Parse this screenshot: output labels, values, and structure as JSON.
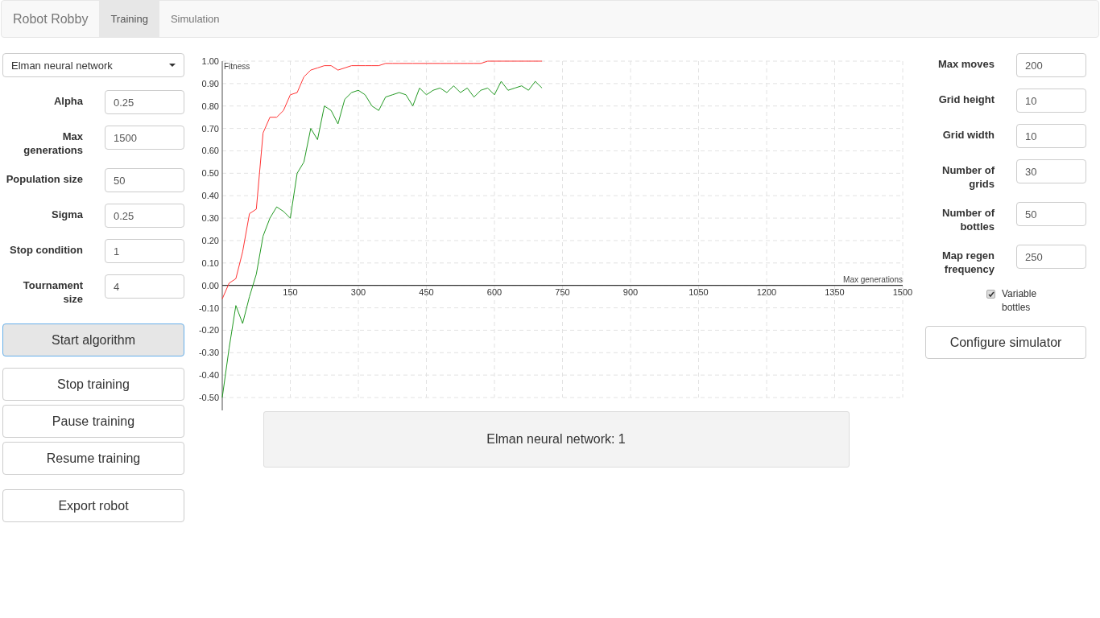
{
  "navbar": {
    "brand": "Robot Robby",
    "tabs": [
      {
        "label": "Training",
        "selected": true
      },
      {
        "label": "Simulation",
        "selected": false
      }
    ]
  },
  "algorithm_select": {
    "value": "Elman neural network"
  },
  "training_params": [
    {
      "label": "Alpha",
      "value": "0.25"
    },
    {
      "label": "Max generations",
      "value": "1500"
    },
    {
      "label": "Population size",
      "value": "50"
    },
    {
      "label": "Sigma",
      "value": "0.25"
    },
    {
      "label": "Stop condition",
      "value": "1"
    },
    {
      "label": "Tournament size",
      "value": "4"
    }
  ],
  "training_buttons": [
    {
      "label": "Start algorithm",
      "focused": true
    },
    {
      "label": "Stop training",
      "focused": false
    },
    {
      "label": "Pause training",
      "focused": false
    },
    {
      "label": "Resume training",
      "focused": false
    },
    {
      "label": "Export robot",
      "focused": false
    }
  ],
  "chart": {
    "chart_data": {
      "type": "line",
      "xlabel": "Max generations",
      "ylabel": "Fitness",
      "x": [
        0,
        15,
        30,
        45,
        60,
        75,
        90,
        105,
        120,
        135,
        150,
        165,
        180,
        195,
        210,
        225,
        240,
        255,
        270,
        285,
        300,
        315,
        330,
        345,
        360,
        375,
        390,
        405,
        420,
        435,
        450,
        465,
        480,
        495,
        510,
        525,
        540,
        555,
        570,
        585,
        600,
        615,
        630,
        645,
        660,
        675,
        690,
        705
      ],
      "grid": true,
      "series": [
        {
          "color": "#ff3333",
          "values": [
            -0.06,
            0.01,
            0.03,
            0.15,
            0.32,
            0.34,
            0.68,
            0.75,
            0.75,
            0.78,
            0.85,
            0.86,
            0.93,
            0.96,
            0.97,
            0.98,
            0.98,
            0.96,
            0.97,
            0.98,
            0.98,
            0.98,
            0.98,
            0.98,
            0.99,
            0.99,
            0.99,
            0.99,
            0.99,
            0.99,
            0.99,
            0.99,
            0.99,
            0.99,
            0.99,
            0.99,
            0.99,
            0.99,
            0.99,
            1.0,
            1.0,
            1.0,
            1.0,
            1.0,
            1.0,
            1.0,
            1.0,
            1.0
          ]
        },
        {
          "color": "#229922",
          "values": [
            -0.5,
            -0.28,
            -0.09,
            -0.17,
            -0.05,
            0.05,
            0.22,
            0.3,
            0.35,
            0.33,
            0.3,
            0.5,
            0.55,
            0.7,
            0.65,
            0.8,
            0.78,
            0.72,
            0.83,
            0.86,
            0.87,
            0.85,
            0.8,
            0.78,
            0.84,
            0.85,
            0.86,
            0.85,
            0.8,
            0.88,
            0.85,
            0.87,
            0.88,
            0.86,
            0.89,
            0.86,
            0.88,
            0.84,
            0.87,
            0.88,
            0.85,
            0.91,
            0.87,
            0.88,
            0.89,
            0.87,
            0.91,
            0.88
          ]
        }
      ],
      "xlim": [
        0,
        1500
      ],
      "ylim": [
        -0.5,
        1.0
      ],
      "xticks": [
        150,
        300,
        450,
        600,
        750,
        900,
        1050,
        1200,
        1350,
        1500
      ],
      "yticks": [
        {
          "value": 1.0,
          "label": "1.00"
        },
        {
          "value": 0.9,
          "label": "0.90"
        },
        {
          "value": 0.8,
          "label": "0.80"
        },
        {
          "value": 0.7,
          "label": "0.70"
        },
        {
          "value": 0.6,
          "label": "0.60"
        },
        {
          "value": 0.5,
          "label": "0.50"
        },
        {
          "value": 0.4,
          "label": "0.40"
        },
        {
          "value": 0.3,
          "label": "0.30"
        },
        {
          "value": 0.2,
          "label": "0.20"
        },
        {
          "value": 0.1,
          "label": "0.10"
        },
        {
          "value": 0.0,
          "label": "0.00"
        },
        {
          "value": -0.1,
          "label": "-0.10"
        },
        {
          "value": -0.2,
          "label": "-0.20"
        },
        {
          "value": -0.3,
          "label": "-0.30"
        },
        {
          "value": -0.4,
          "label": "-0.40"
        },
        {
          "value": -0.5,
          "label": "-0.50"
        }
      ]
    }
  },
  "status": "Elman neural network: 1",
  "simulator_params": [
    {
      "label": "Max moves",
      "value": "200"
    },
    {
      "label": "Grid height",
      "value": "10"
    },
    {
      "label": "Grid width",
      "value": "10"
    },
    {
      "label": "Number of grids",
      "value": "30"
    },
    {
      "label": "Number of bottles",
      "value": "50"
    },
    {
      "label": "Map regen frequency",
      "value": "250"
    }
  ],
  "variable_bottles": {
    "label": "Variable bottles",
    "checked": true
  },
  "configure_button": "Configure simulator"
}
